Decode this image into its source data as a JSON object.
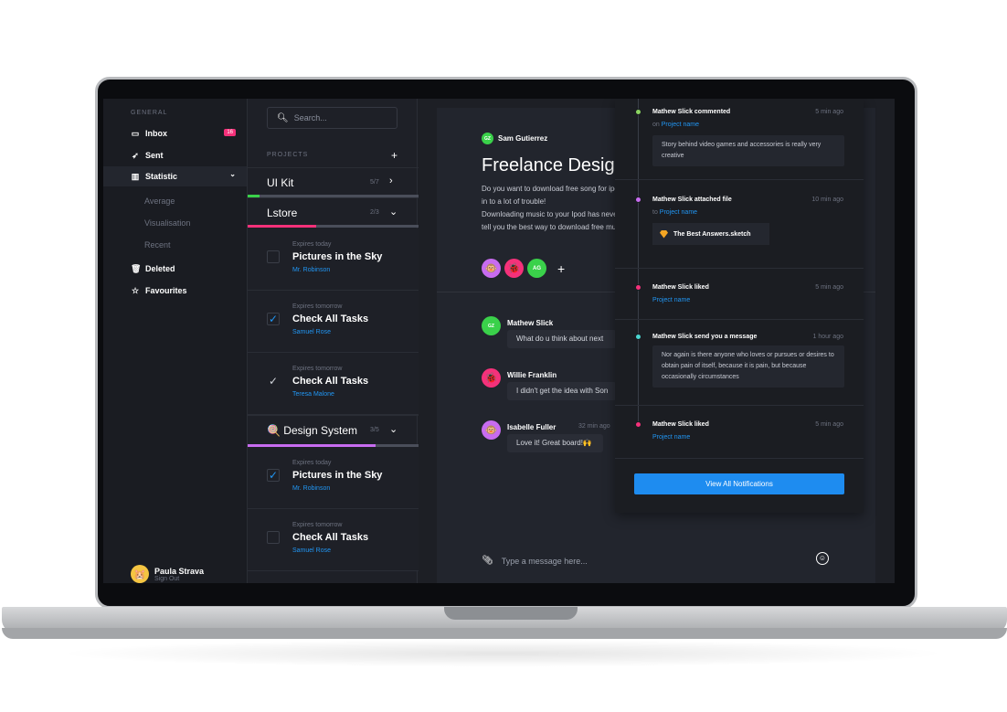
{
  "sidebar": {
    "section_label": "GENERAL",
    "items": [
      {
        "label": "Inbox",
        "icon": "inbox-icon",
        "badge": "16"
      },
      {
        "label": "Sent",
        "icon": "send-icon"
      },
      {
        "label": "Statistic",
        "icon": "chart-icon"
      },
      {
        "label": "Deleted",
        "icon": "trash-icon"
      },
      {
        "label": "Favourites",
        "icon": "star-icon"
      }
    ],
    "sub_items": [
      "Average",
      "Visualisation",
      "Recent"
    ],
    "user": {
      "name": "Paula Strava",
      "sub": "Sign Out"
    }
  },
  "projects": {
    "search_placeholder": "Search...",
    "section_label": "PROJECTS",
    "add_label": "+",
    "list": [
      {
        "name": "UI Kit",
        "count": "5/7",
        "progress": 0.07,
        "color": "#3ad14a"
      },
      {
        "name": "Lstore",
        "count": "2/3",
        "progress": 0.4,
        "color": "#f5317a"
      },
      {
        "name": "Design System",
        "count": "3/5",
        "progress": 0.75,
        "color": "#c86cf0"
      }
    ],
    "tasks_lstore": [
      {
        "expires": "Expires today",
        "title": "Pictures in the Sky",
        "who": "Mr. Robinson",
        "checked": false
      },
      {
        "expires": "Expires tomorrow",
        "title": "Check All Tasks",
        "who": "Samuel Rose",
        "checked": true
      },
      {
        "expires": "Expires tomorrow",
        "title": "Check All Tasks",
        "who": "Teresa Malone",
        "checked": true
      }
    ],
    "tasks_design": [
      {
        "expires": "Expires today",
        "title": "Pictures in the Sky",
        "who": "Mr. Robinson",
        "checked": true
      },
      {
        "expires": "Expires tomorrow",
        "title": "Check All Tasks",
        "who": "Samuel Rose",
        "checked": false
      }
    ]
  },
  "main": {
    "author_initials": "GZ",
    "author": "Sam Gutierrez",
    "title": "Freelance Design",
    "body": [
      "Do you want to download free song for ipod? If so, reading",
      "in to a lot of trouble!",
      "Downloading music to your Ipod has never been easier.",
      "tell you the best way to download free music"
    ],
    "avatar_initials": "AG",
    "messages": [
      {
        "name": "Mathew Slick",
        "initials": "GZ",
        "text": "What do u think about next",
        "time": ""
      },
      {
        "name": "Willie Franklin",
        "initials": "",
        "text": "I didn't get the idea with Son",
        "time": ""
      },
      {
        "name": "Isabelle Fuller",
        "initials": "",
        "text": "Love it! Great board!🙌",
        "time": "32 min ago"
      }
    ],
    "composer_placeholder": "Type a message here..."
  },
  "notifications": {
    "items": [
      {
        "title": "Mathew Slick commented",
        "time": "5 min ago",
        "prefix": "on",
        "link": "Project name",
        "box": "Story behind video games and accessories is really very creative",
        "dot": "#8bd460"
      },
      {
        "title": "Mathew Slick attached file",
        "time": "10 min ago",
        "prefix": "to",
        "link": "Project name",
        "file": "The Best Answers.sketch",
        "dot": "#c86cf0"
      },
      {
        "title": "Mathew Slick liked",
        "time": "5 min ago",
        "link": "Project name",
        "dot": "#f5317a"
      },
      {
        "title": "Mathew Slick send you a message",
        "time": "1 hour ago",
        "box": "Nor again is there anyone who loves or pursues or desires to obtain pain of itself, because it is pain, but because occasionally circumstances",
        "dot": "#4ad6d0"
      },
      {
        "title": "Mathew Slick liked",
        "time": "5 min ago",
        "link": "Project name",
        "dot": "#f5317a"
      }
    ],
    "view_all": "View All Notifications"
  },
  "colors": {
    "accent": "#2196f3",
    "pink": "#f5317a",
    "green": "#3ad14a"
  }
}
